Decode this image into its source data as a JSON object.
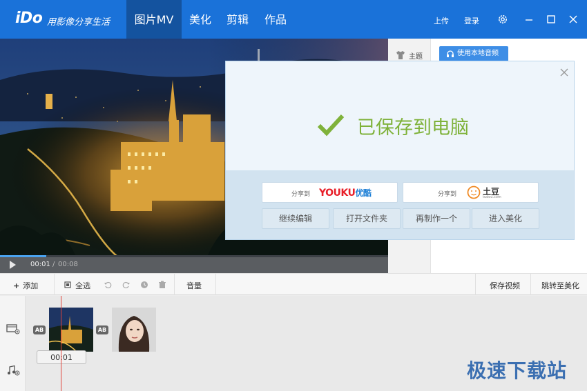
{
  "app": {
    "logo": "iDo",
    "slogan": "用影像分享生活"
  },
  "tabs": [
    {
      "label": "图片MV",
      "active": true
    },
    {
      "label": "美化",
      "active": false
    },
    {
      "label": "剪辑",
      "active": false
    },
    {
      "label": "作品",
      "active": false
    }
  ],
  "titlebar": {
    "upload": "上传",
    "login": "登录"
  },
  "player": {
    "current_time": "00:01",
    "separator": "/",
    "total_time": "00:08",
    "progress_percent": 12
  },
  "right_panel": {
    "theme_label": "主题",
    "local_music_button": "使用本地音频"
  },
  "toolbar": {
    "add": "添加",
    "select_all": "全选",
    "volume": "音量",
    "save_video": "保存视频",
    "jump_beautify": "跳转至美化"
  },
  "timeline": {
    "ab_label": "AB",
    "clip_time": "00:01"
  },
  "dialog": {
    "message": "已保存到电脑",
    "share_to": "分享到",
    "youku_brand": "YOUKU",
    "youku_cn": "优酷",
    "tudou_brand": "土豆",
    "tudou_sub": "tudou.com",
    "actions": [
      "继续编辑",
      "打开文件夹",
      "再制作一个",
      "进入美化"
    ]
  },
  "watermark": "极速下载站",
  "colors": {
    "brand_blue": "#1a72d9",
    "active_tab": "#14539f",
    "success_green": "#7fb23a",
    "youku_red": "#e8202a",
    "youku_blue": "#1d7fd6",
    "tudou_orange": "#f08a24"
  }
}
